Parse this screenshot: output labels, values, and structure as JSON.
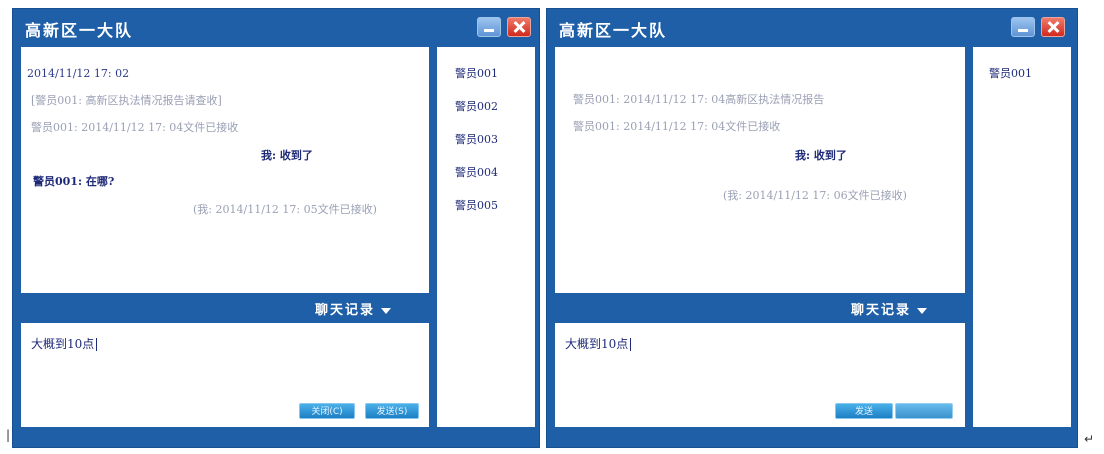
{
  "window1": {
    "title": "高新区一大队",
    "history_label": "聊天记录",
    "messages": [
      {
        "text": "2014/11/12  17: 02"
      },
      {
        "text": "[警员001:        高新区执法情况报告请查收]"
      },
      {
        "text": "警员001:  2014/11/12  17: 04文件已接收"
      },
      {
        "text": "我: 收到了"
      },
      {
        "text": "警员001: 在哪?"
      },
      {
        "text": "(我: 2014/11/12  17: 05文件已接收)"
      }
    ],
    "users": [
      "警员001",
      "警员002",
      "警员003",
      "警员004",
      "警员005"
    ],
    "input_text": "大概到10点",
    "buttons": [
      "关闭(C)",
      "发送(S)"
    ]
  },
  "window2": {
    "title": "高新区一大队",
    "history_label": "聊天记录",
    "messages": [
      {
        "text": "警员001: 2014/11/12  17: 04高新区执法情况报告"
      },
      {
        "text": "警员001:  2014/11/12  17: 04文件已接收"
      },
      {
        "text": "我: 收到了"
      },
      {
        "text": "(我: 2014/11/12  17: 06文件已接收)"
      }
    ],
    "users": [
      "警员001"
    ],
    "input_text": "大概到10点",
    "buttons": [
      "发送"
    ]
  },
  "colors": {
    "frame": "#1f5fa8",
    "panel": "#ffffff",
    "text": "#1e2a78",
    "dim_text": "#9aa0b4",
    "button": "#1c7fc4",
    "close": "#cf2a1d"
  },
  "icons": [
    "minimize-icon",
    "close-icon",
    "chevron-down-icon"
  ],
  "edge_marks": [
    "|",
    "↵"
  ]
}
